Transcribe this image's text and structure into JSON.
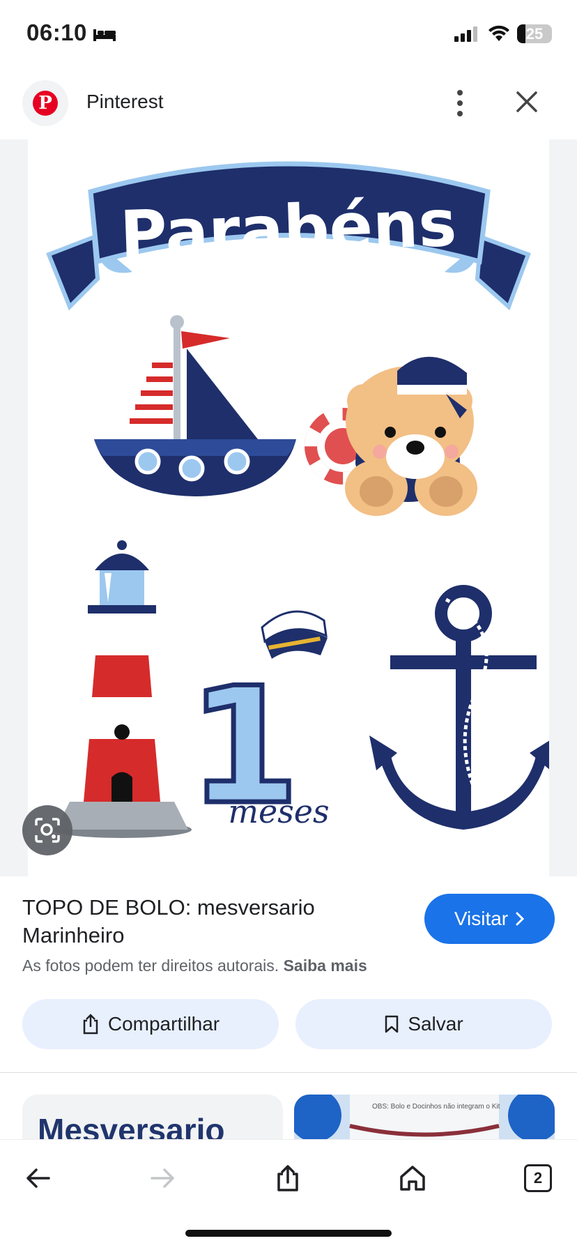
{
  "status_bar": {
    "time": "06:10",
    "battery": "25"
  },
  "header": {
    "source_name": "Pinterest",
    "icons": [
      "pinterest-logo",
      "more-vert-icon",
      "close-icon"
    ]
  },
  "image": {
    "banner_text": "Parabéns",
    "number_text": "1",
    "meses_text": "meses",
    "colors": {
      "navy": "#1e2f6b",
      "light_blue": "#9cc8ef",
      "red": "#d62b2b",
      "bear": "#f2bf85"
    }
  },
  "result": {
    "title": "TOPO DE BOLO: mesversario Marinheiro",
    "visit_label": "Visitar",
    "copyright_text": "As fotos podem ter direitos autorais.",
    "learn_more": "Saiba mais",
    "share_label": "Compartilhar",
    "save_label": "Salvar"
  },
  "related": {
    "thumb1_text": "Mesversario",
    "thumb2_caption": "OBS: Bolo e Docinhos não integram o Kit"
  },
  "bottom_nav": {
    "tabs_count": "2",
    "accent": "#1a73e8"
  }
}
